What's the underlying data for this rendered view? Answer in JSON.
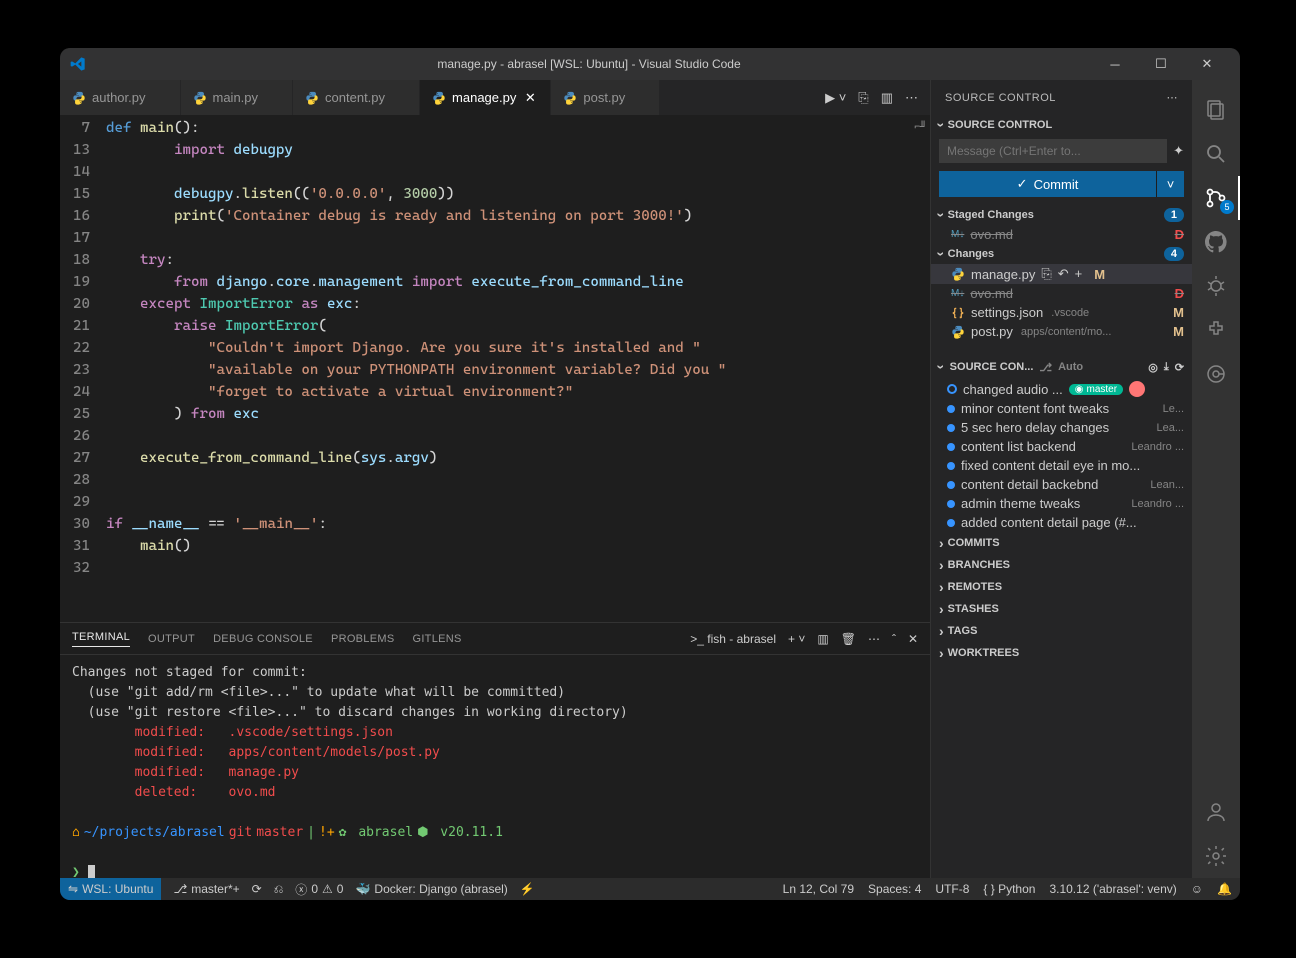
{
  "titlebar": {
    "title": "manage.py - abrasel [WSL: Ubuntu] - Visual Studio Code"
  },
  "tabs": [
    {
      "label": "author.py"
    },
    {
      "label": "main.py"
    },
    {
      "label": "content.py"
    },
    {
      "label": "manage.py",
      "active": true
    },
    {
      "label": "post.py"
    }
  ],
  "editor": {
    "lines": [
      7,
      13,
      14,
      15,
      16,
      17,
      18,
      19,
      20,
      21,
      22,
      23,
      24,
      25,
      26,
      27,
      28,
      29,
      30,
      31,
      32
    ]
  },
  "terminal": {
    "tabs": [
      "TERMINAL",
      "OUTPUT",
      "DEBUG CONSOLE",
      "PROBLEMS",
      "GITLENS"
    ],
    "active": 0,
    "shell": "fish - abrasel",
    "lines": [
      "Changes not staged for commit:",
      "  (use \"git add/rm <file>...\" to update what will be committed)",
      "  (use \"git restore <file>...\" to discard changes in working directory)"
    ],
    "mods": [
      "        modified:   .vscode/settings.json",
      "        modified:   apps/content/models/post.py",
      "        modified:   manage.py",
      "        deleted:    ovo.md"
    ],
    "prompt": {
      "path": "~/projects/abrasel",
      "branch": "master",
      "flags": "!+",
      "proj": "abrasel",
      "node": "v20.11.1"
    }
  },
  "scm_title": "SOURCE CONTROL",
  "scm_section": "SOURCE CONTROL",
  "scm_placeholder": "Message (Ctrl+Enter to...",
  "commit_label": "Commit",
  "staged": {
    "label": "Staged Changes",
    "count": "1",
    "files": [
      {
        "name": "ovo.md",
        "status": "D",
        "color": "#f14c4c",
        "icon": "md",
        "strike": true
      }
    ]
  },
  "changes": {
    "label": "Changes",
    "count": "4",
    "files": [
      {
        "name": "manage.py",
        "status": "M",
        "color": "#e2c08d",
        "icon": "py",
        "active": true,
        "actions": true
      },
      {
        "name": "ovo.md",
        "status": "D",
        "color": "#f14c4c",
        "icon": "md",
        "strike": true
      },
      {
        "name": "settings.json",
        "path": ".vscode",
        "status": "M",
        "color": "#e2c08d",
        "icon": "json"
      },
      {
        "name": "post.py",
        "path": "apps/content/mo...",
        "status": "M",
        "color": "#e2c08d",
        "icon": "py"
      }
    ]
  },
  "graph": {
    "title": "SOURCE CON...",
    "auto": "Auto",
    "commits": [
      {
        "msg": "changed audio ...",
        "branch": "master",
        "head": true
      },
      {
        "msg": "minor content font tweaks",
        "auth": "Le..."
      },
      {
        "msg": "5 sec hero delay changes",
        "auth": "Lea..."
      },
      {
        "msg": "content list backend",
        "auth": "Leandro ..."
      },
      {
        "msg": "fixed content detail eye in mo..."
      },
      {
        "msg": "content detail backebnd",
        "auth": "Lean..."
      },
      {
        "msg": "admin theme tweaks",
        "auth": "Leandro ..."
      },
      {
        "msg": "added content detail page (#..."
      }
    ]
  },
  "sections": [
    "COMMITS",
    "BRANCHES",
    "REMOTES",
    "STASHES",
    "TAGS",
    "WORKTREES"
  ],
  "statusbar": {
    "remote": "WSL: Ubuntu",
    "branch": "master*+",
    "errors": "0",
    "warnings": "0",
    "docker": "Docker: Django (abrasel)",
    "pos": "Ln 12, Col 79",
    "spaces": "Spaces: 4",
    "enc": "UTF-8",
    "lang": "{ }  Python",
    "interp": "3.10.12 ('abrasel': venv)"
  }
}
